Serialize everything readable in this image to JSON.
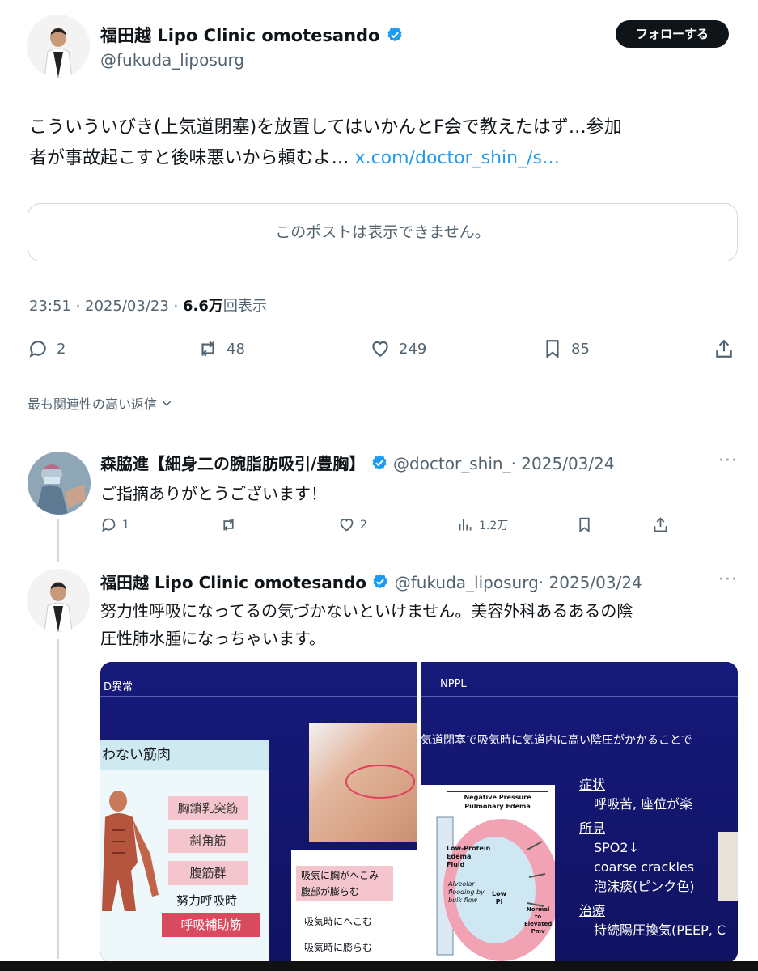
{
  "main_post": {
    "display_name": "福田越 Lipo Clinic omotesando",
    "handle": "@fukuda_liposurg",
    "follow_label": "フォローする",
    "text_line1": "こういういびき(上気道閉塞)を放置してはいかんとF会で教えたはず…参加",
    "text_line2": "者が事故起こすと後味悪いから頼むよ…",
    "link": "x.com/doctor_shin_/s…",
    "quote_unavailable": "このポストは表示できません。",
    "time": "23:51 · 2025/03/23 · ",
    "views_count": "6.6万",
    "views_label": "回表示",
    "replies": "2",
    "reposts": "48",
    "likes": "249",
    "bookmarks": "85"
  },
  "sort_label": "最も関連性の高い返信",
  "reply1": {
    "display_name": "森脇進【細身二の腕脂肪吸引/豊胸】",
    "handle": "@doctor_shin_",
    "date": "· 2025/03/24",
    "text": "ご指摘ありがとうございます！",
    "replies": "1",
    "likes": "2",
    "views": "1.2万",
    "more": "···"
  },
  "reply2": {
    "display_name": "福田越 Lipo Clinic omotesando",
    "handle": "@fukuda_liposurg",
    "date": "· 2025/03/24",
    "text_line1": "努力性呼吸になってるの気づかないといけません。美容外科あるあるの陰",
    "text_line2": "圧性肺水腫になっちゃいます。",
    "more": "···"
  },
  "media_left": {
    "header": "D異常",
    "section": "わない筋肉",
    "muscles": [
      "胸鎖乳突筋",
      "斜角筋",
      "腹筋群"
    ],
    "caption": "努力呼吸時",
    "accessory": "呼吸補助筋",
    "box1_line1": "吸気に胸がへこみ",
    "box1_line2": "腹部が膨らむ",
    "row1": "吸気時にへこむ",
    "row2": "吸気時に膨らむ"
  },
  "media_right": {
    "header": "NPPL",
    "banner": "気道閉塞で吸気時に気道内に高い陰圧がかかることで",
    "diagram_title_1": "Negative Pressure",
    "diagram_title_2": "Pulmonary Edema",
    "diagram_label_1": "Low-Protein",
    "diagram_label_2": "Edema",
    "diagram_label_3": "Fluid",
    "diagram_label_4": "Alveolar",
    "diagram_label_5": "flooding by",
    "diagram_label_6": "bulk flow",
    "diagram_low": "Low",
    "diagram_pi": "Pi",
    "diagram_normal_1": "Normal",
    "diagram_normal_2": "to",
    "diagram_normal_3": "Elevated",
    "diagram_normal_4": "Pmv",
    "h1": "症状",
    "s1": "呼吸苦, 座位が楽",
    "h2": "所見",
    "f1": "SPO2↓",
    "f2": "coarse crackles",
    "f3": "泡沫痰(ピンク色)",
    "h3": "治療",
    "t1": "持続陽圧換気(PEEP, C"
  },
  "colors": {
    "accent": "#1d9bf0",
    "slide_bg": "#161a7a",
    "pink": "#f4c5cd"
  }
}
